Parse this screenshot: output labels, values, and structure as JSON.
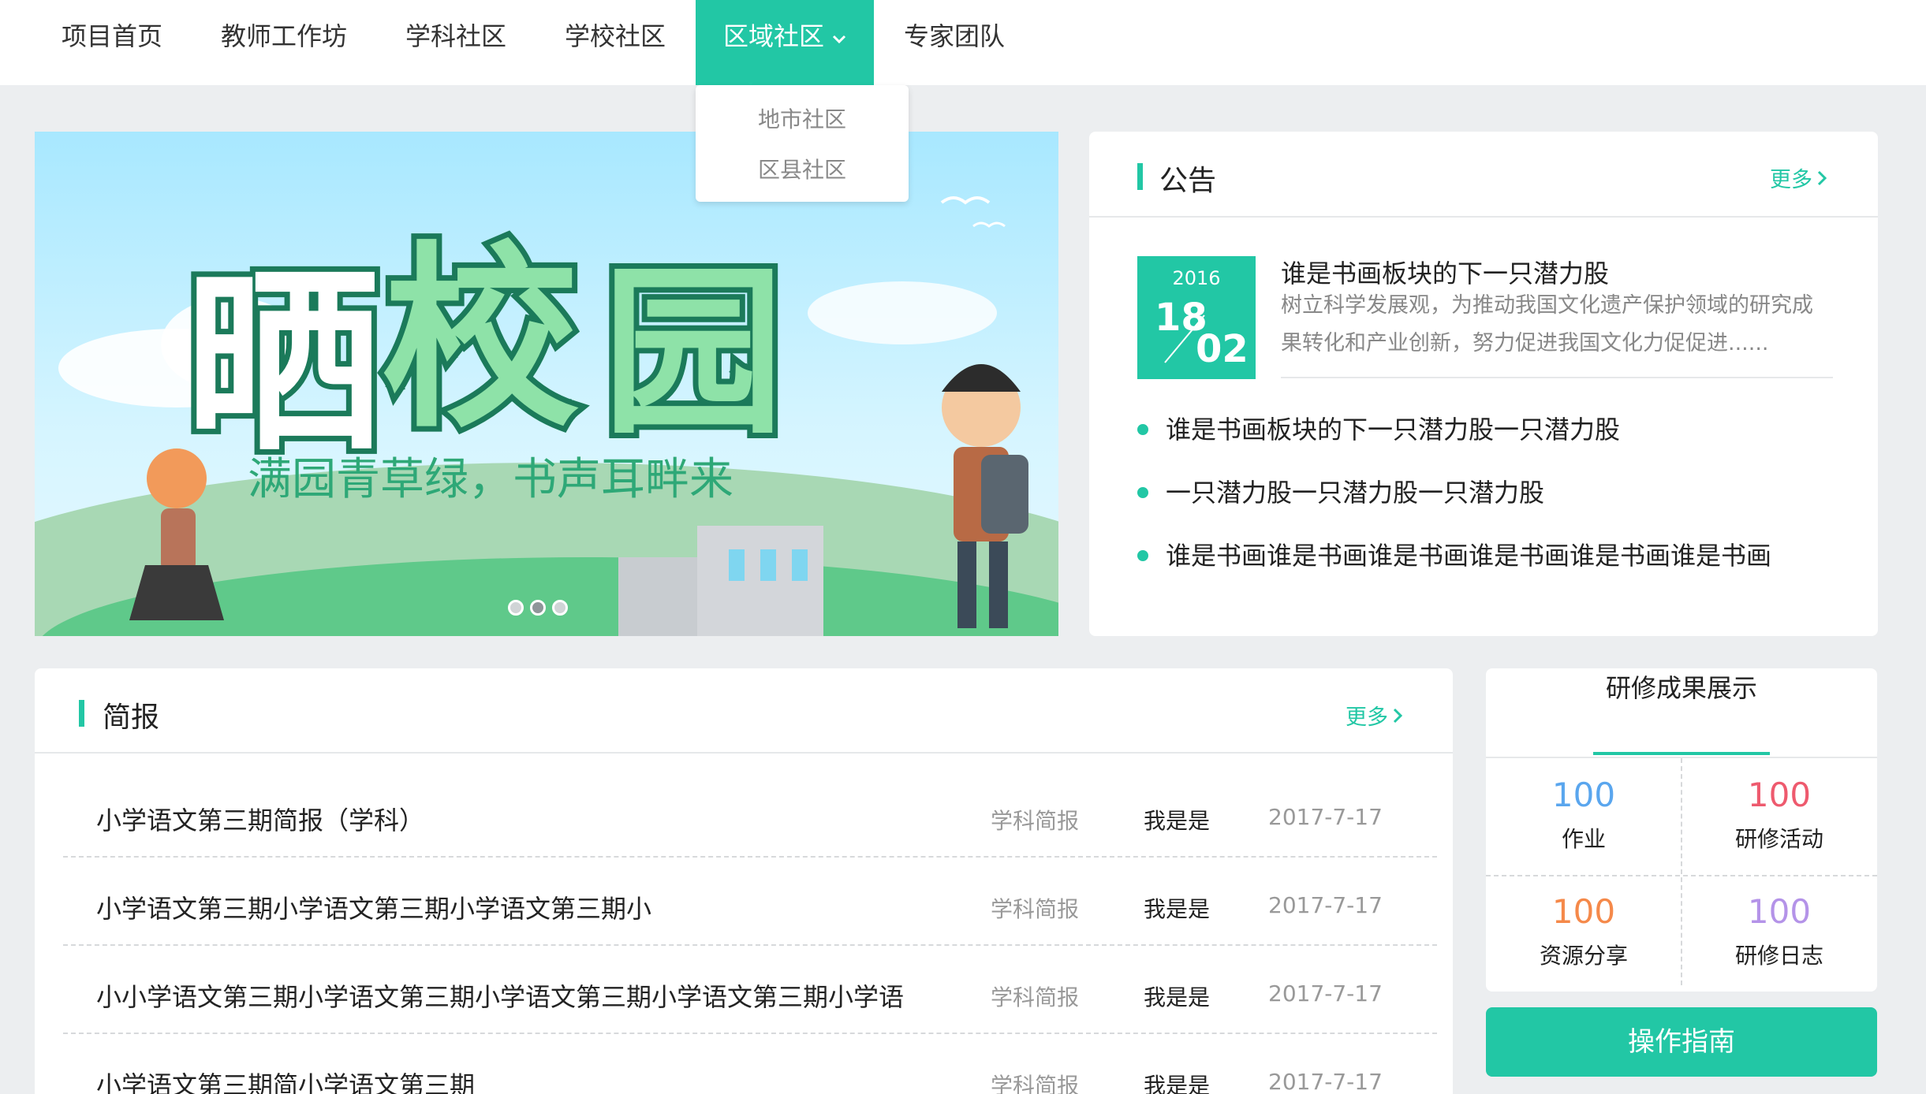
{
  "nav": {
    "items": [
      "项目首页",
      "教师工作坊",
      "学科社区",
      "学校社区",
      "区域社区",
      "专家团队"
    ],
    "active_index": 4,
    "dropdown": [
      "地市社区",
      "区县社区"
    ]
  },
  "banner": {
    "headline": "晒校园",
    "slogan": "满园青草绿，书声耳畔来",
    "slide_count": 3,
    "active_slide": 1
  },
  "notice": {
    "title": "公告",
    "more": "更多",
    "featured": {
      "year": "2016",
      "day": "18",
      "month": "02",
      "title": "谁是书画板块的下一只潜力股",
      "desc": "树立科学发展观，为推动我国文化遗产保护领域的研究成果转化和产业创新，努力促进我国文化力促促进......"
    },
    "items": [
      "谁是书画板块的下一只潜力股一只潜力股",
      "一只潜力股一只潜力股一只潜力股",
      "谁是书画谁是书画谁是书画谁是书画谁是书画谁是书画"
    ]
  },
  "brief": {
    "title": "简报",
    "more": "更多",
    "rows": [
      {
        "title": "小学语文第三期简报（学科）",
        "category": "学科简报",
        "author": "我是是",
        "date": "2017-7-17"
      },
      {
        "title": "小学语文第三期小学语文第三期小学语文第三期小",
        "category": "学科简报",
        "author": "我是是",
        "date": "2017-7-17"
      },
      {
        "title": "小小学语文第三期小学语文第三期小学语文第三期小学语文第三期小学语",
        "category": "学科简报",
        "author": "我是是",
        "date": "2017-7-17"
      },
      {
        "title": "小学语文第三期简小学语文第三期",
        "category": "学科简报",
        "author": "我是是",
        "date": "2017-7-17"
      }
    ]
  },
  "results": {
    "tab": "研修成果展示",
    "cells": [
      {
        "value": "100",
        "label": "作业",
        "color": "#5aa6ee"
      },
      {
        "value": "100",
        "label": "研修活动",
        "color": "#ee5a6e"
      },
      {
        "value": "100",
        "label": "资源分享",
        "color": "#f5894a"
      },
      {
        "value": "100",
        "label": "研修日志",
        "color": "#b493e8"
      }
    ]
  },
  "guide_button": "操作指南",
  "colors": {
    "accent": "#22c7a5",
    "background": "#eceef0"
  }
}
